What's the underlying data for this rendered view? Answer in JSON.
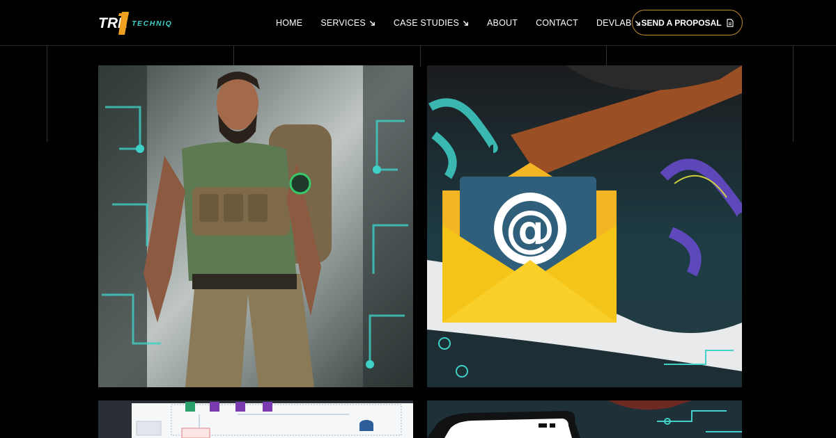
{
  "brand": {
    "logo_tre": "TRE",
    "logo_techniq": "TECHNIQ"
  },
  "nav": {
    "items": [
      {
        "label": "HOME",
        "has_arrow": false
      },
      {
        "label": "SERVICES",
        "has_arrow": true
      },
      {
        "label": "CASE STUDIES",
        "has_arrow": true
      },
      {
        "label": "ABOUT",
        "has_arrow": false
      },
      {
        "label": "CONTACT",
        "has_arrow": false
      },
      {
        "label": "DEVLAB",
        "has_arrow": true
      }
    ],
    "cta_label": "SEND A PROPOSAL"
  },
  "colors": {
    "background": "#000000",
    "cta_border": "#c58a2e",
    "accent_orange": "#f0a020",
    "accent_teal": "#3fd0c8"
  },
  "gallery": {
    "tiles": [
      {
        "subject": "bearded soldier with backpack illustration"
      },
      {
        "subject": "email envelope with at-sign illustration"
      },
      {
        "subject": "architecture diagram screenshot"
      },
      {
        "subject": "smartphone mockup illustration"
      }
    ]
  }
}
